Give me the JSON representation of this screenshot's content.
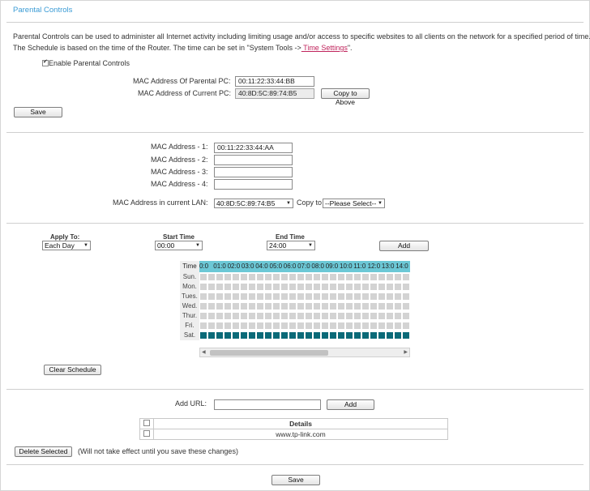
{
  "title": "Parental Controls",
  "description": {
    "line1": "Parental Controls can be used to administer all Internet activity including limiting usage and/or access to specific websites to all clients on the network for a specified period of time.",
    "line2_prefix": "The Schedule is based on the time of the Router. The time can be set in \"System Tools ->",
    "line2_link": " Time Settings",
    "line2_suffix": "\"."
  },
  "enable": {
    "label": "Enable Parental Controls",
    "checked": true
  },
  "parental_pc": {
    "mac_label": "MAC Address Of Parental PC:",
    "mac_value": "00:11:22:33:44:BB",
    "current_label": "MAC Address of Current PC:",
    "current_value": "40:8D:5C:89:74:B5",
    "copy_button": "Copy to Above"
  },
  "save_top": "Save",
  "children": {
    "mac1_label": "MAC Address - 1:",
    "mac1_value": "00:11:22:33:44:AA",
    "mac2_label": "MAC Address - 2:",
    "mac2_value": "",
    "mac3_label": "MAC Address - 3:",
    "mac3_value": "",
    "mac4_label": "MAC Address - 4:",
    "mac4_value": "",
    "lan_label": "MAC Address in current LAN:",
    "lan_value": "40:8D:5C:89:74:B5",
    "copy_to_label": "Copy to",
    "copy_to_value": "--Please Select--"
  },
  "schedule": {
    "apply_label": "Apply To:",
    "apply_value": "Each Day",
    "start_label": "Start Time",
    "start_value": "00:00",
    "end_label": "End Time",
    "end_value": "24:00",
    "add_button": "Add",
    "time_header": "Time",
    "hours": [
      "0:0",
      "01:0",
      "02:0",
      "03:0",
      "04:0",
      "05:0",
      "06:0",
      "07:0",
      "08:0",
      "09:0",
      "10:0",
      "11:0",
      "12:0",
      "13:0",
      "14:0"
    ],
    "days": [
      "Sun.",
      "Mon.",
      "Tues.",
      "Wed.",
      "Thur.",
      "Fri.",
      "Sat."
    ],
    "selected_day": "Sat.",
    "clear_button": "Clear Schedule"
  },
  "urls": {
    "add_label": "Add URL:",
    "add_value": "",
    "add_button": "Add",
    "details_header": "Details",
    "rows": [
      "www.tp-link.com"
    ]
  },
  "delete_button": "Delete Selected",
  "delete_note": "(Will not take effect until you save these changes)",
  "save_bottom": "Save",
  "colors": {
    "title": "#3a9bd5",
    "link": "#c0245c",
    "grid_header": "#6cc8d6",
    "grid_selected": "#0a6a78",
    "grid_cell": "#d3d3d3"
  }
}
